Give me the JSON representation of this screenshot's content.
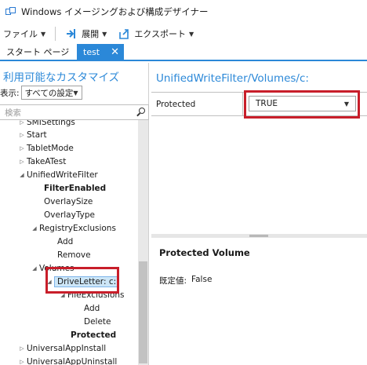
{
  "window": {
    "title": "Windows イメージングおよび構成デザイナー"
  },
  "toolbar": {
    "file_label": "ファイル",
    "deploy_label": "展開",
    "export_label": "エクスポート"
  },
  "tabs": [
    {
      "label": "スタート ページ"
    },
    {
      "label": "test",
      "close": "✕"
    }
  ],
  "left_panel": {
    "title": "利用可能なカスタマイズ",
    "filter_label": "表示:",
    "filter_value": "すべての設定",
    "search_placeholder": "検索"
  },
  "tree": [
    {
      "label": "SMISettings",
      "expander": "▷"
    },
    {
      "label": "Start",
      "expander": "▷"
    },
    {
      "label": "TabletMode",
      "expander": "▷"
    },
    {
      "label": "TakeATest",
      "expander": "▷"
    },
    {
      "label": "UnifiedWriteFilter",
      "expander": "◢"
    },
    {
      "label": "FilterEnabled",
      "bold": true
    },
    {
      "label": "OverlaySize"
    },
    {
      "label": "OverlayType"
    },
    {
      "label": "RegistryExclusions",
      "expander": "◢"
    },
    {
      "label": "Add"
    },
    {
      "label": "Remove"
    },
    {
      "label": "Volumes",
      "expander": "◢"
    },
    {
      "label": "DriveLetter: c:",
      "expander": "◢",
      "selected": true
    },
    {
      "label": "FileExclusions",
      "expander": "◢"
    },
    {
      "label": "Add"
    },
    {
      "label": "Delete"
    },
    {
      "label": "Protected",
      "bold": true
    },
    {
      "label": "UniversalAppInstall",
      "expander": "▷"
    },
    {
      "label": "UniversalAppUninstall",
      "expander": "▷"
    }
  ],
  "right_panel": {
    "path_title": "UnifiedWriteFilter/Volumes/c:",
    "property_label": "Protected",
    "property_value": "TRUE",
    "description_title": "Protected Volume",
    "default_label": "既定値:",
    "default_value": "False"
  },
  "colors": {
    "accent": "#2b88d8",
    "highlight": "#c81e2a",
    "selection": "#cde6f7"
  }
}
